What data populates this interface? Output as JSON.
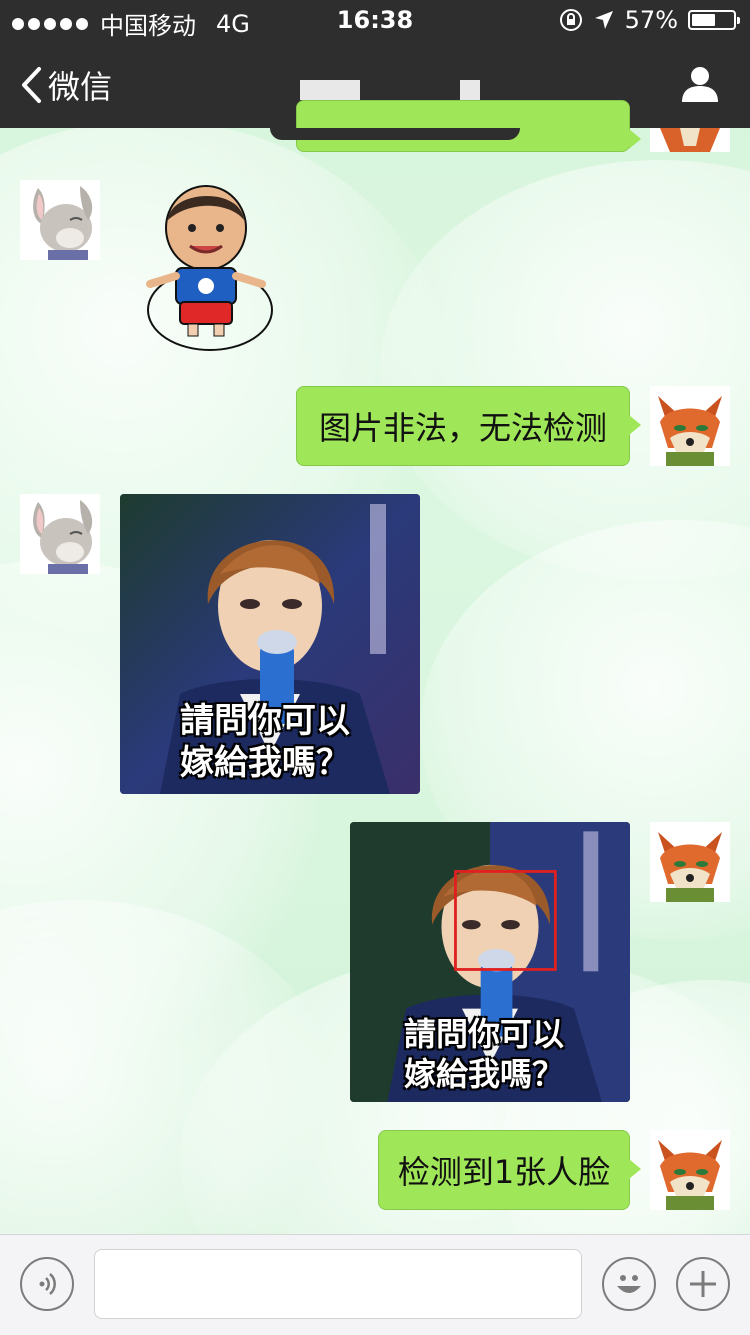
{
  "status_bar": {
    "carrier": "中国移动",
    "network": "4G",
    "time": "16:38",
    "battery": "57%",
    "battery_level": 0.57
  },
  "nav": {
    "back_label": "微信"
  },
  "messages": [
    {
      "side": "right",
      "type": "text",
      "text": ""
    },
    {
      "side": "left",
      "type": "sticker",
      "avatar": "bunny-avatar"
    },
    {
      "side": "right",
      "type": "text",
      "text": "图片非法，无法检测"
    },
    {
      "side": "left",
      "type": "image",
      "caption_line1": "請問你可以",
      "caption_line2": "嫁給我嗎？"
    },
    {
      "side": "right",
      "type": "image",
      "caption_line1": "請問你可以",
      "caption_line2": "嫁給我嗎？"
    },
    {
      "side": "right",
      "type": "text",
      "text": "检测到1张人脸"
    }
  ],
  "colors": {
    "bar_bg": "#2e2e2e",
    "bubble_green": "#9fe658",
    "face_box": "#e02020"
  },
  "input_bar": {
    "voice_icon": "voice-icon",
    "emoji_icon": "emoji-icon",
    "plus_icon": "plus-icon"
  }
}
